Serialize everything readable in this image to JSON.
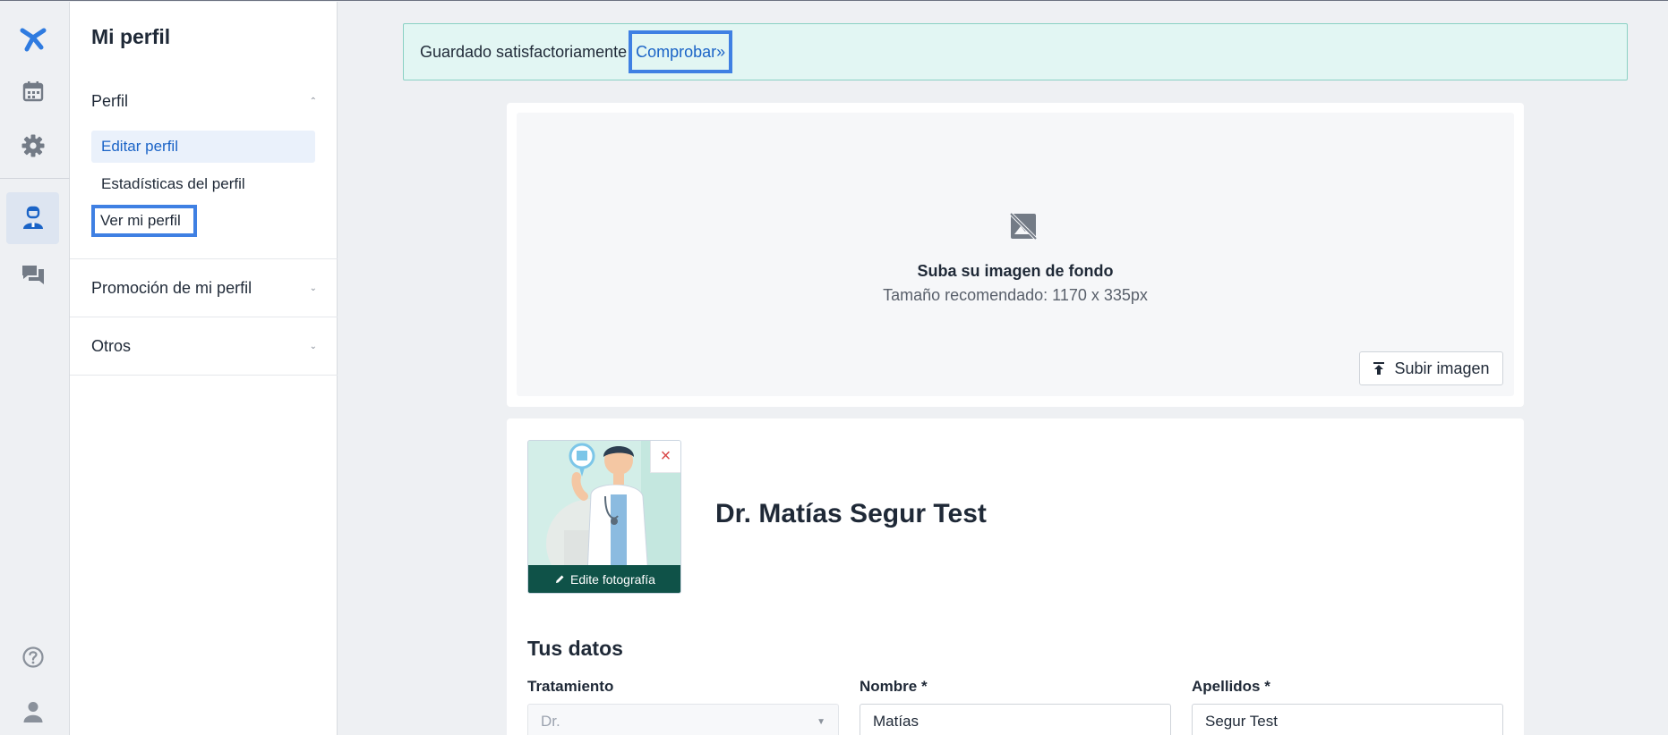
{
  "rail": {
    "items": [
      {
        "icon": "logo-icon"
      },
      {
        "icon": "calendar-icon"
      },
      {
        "icon": "gear-icon"
      },
      {
        "icon": "doctor-profile-icon",
        "active": true
      },
      {
        "icon": "chat-icon"
      },
      {
        "icon": "help-icon"
      },
      {
        "icon": "user-icon"
      }
    ]
  },
  "subnav": {
    "title": "Mi perfil",
    "sections": [
      {
        "label": "Perfil",
        "expanded": true,
        "items": [
          {
            "label": "Editar perfil",
            "active": true
          },
          {
            "label": "Estadísticas del perfil"
          },
          {
            "label": "Ver mi perfil",
            "focused": true
          }
        ]
      },
      {
        "label": "Promoción de mi perfil",
        "expanded": false
      },
      {
        "label": "Otros",
        "expanded": false
      }
    ]
  },
  "banner": {
    "message": "Guardado satisfactoriamente",
    "link": "Comprobar»"
  },
  "cover": {
    "title": "Suba su imagen de fondo",
    "subtitle": "Tamaño recomendado: 1170 x 335px",
    "upload_label": "Subir imagen"
  },
  "profile": {
    "photo_edit_label": "Edite fotografía",
    "remove_symbol": "×",
    "name": "Dr. Matías Segur Test"
  },
  "form": {
    "section_title": "Tus datos",
    "fields": [
      {
        "label": "Tratamiento",
        "value": "Dr.",
        "disabled": true
      },
      {
        "label": "Nombre *",
        "value": "Matías"
      },
      {
        "label": "Apellidos *",
        "value": "Segur Test"
      }
    ]
  },
  "colors": {
    "accent": "#1b64c7",
    "focus_outline": "#3f80e3",
    "success_bg": "#e2f6f3",
    "photo_bar": "#0f5248"
  }
}
